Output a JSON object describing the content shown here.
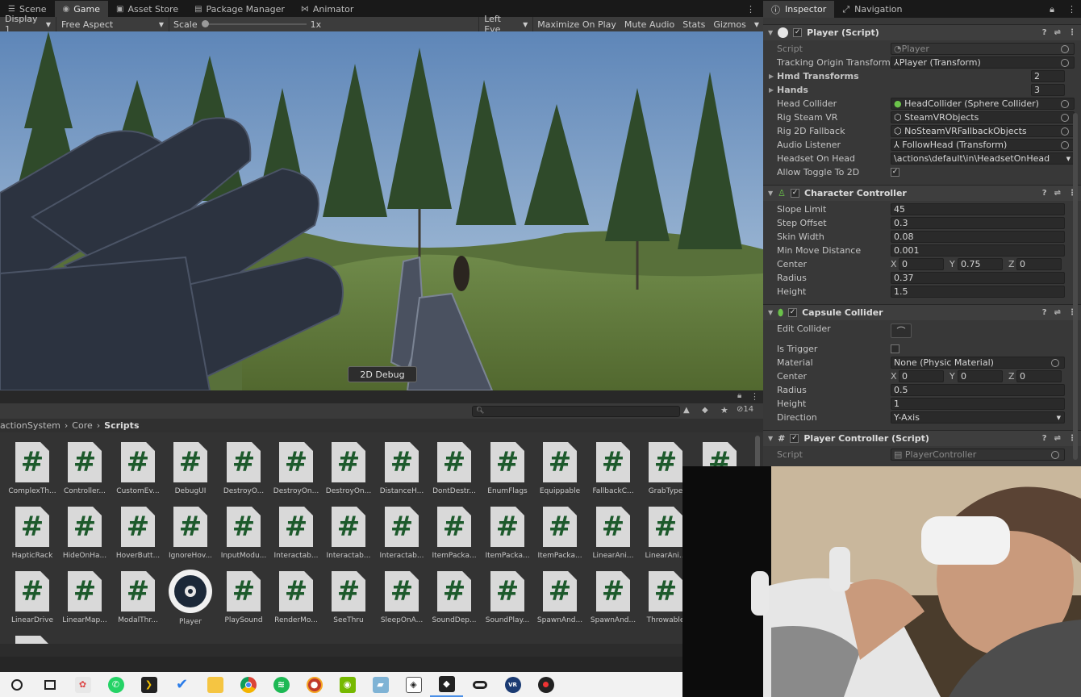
{
  "tabs": {
    "scene": "Scene",
    "game": "Game",
    "asset_store": "Asset Store",
    "package_manager": "Package Manager",
    "animator": "Animator"
  },
  "game_toolbar": {
    "display": "Display 1",
    "aspect": "Free Aspect",
    "scale_label": "Scale",
    "scale_value": "1x",
    "eye": "Left Eye",
    "maximize": "Maximize On Play",
    "mute": "Mute Audio",
    "stats": "Stats",
    "gizmos": "Gizmos"
  },
  "game_view": {
    "debug_button": "2D Debug"
  },
  "project": {
    "hidden_count": "14",
    "breadcrumb": [
      "actionSystem",
      "Core",
      "Scripts"
    ],
    "assets": [
      "ComplexTh...",
      "Controller...",
      "CustomEv...",
      "DebugUI",
      "DestroyO...",
      "DestroyOn...",
      "DestroyOn...",
      "DistanceH...",
      "DontDestr...",
      "EnumFlags",
      "Equippable",
      "FallbackC...",
      "GrabType",
      "HapticRack",
      "HideOnHa...",
      "HoverButt...",
      "IgnoreHov...",
      "InputModu...",
      "Interactab...",
      "Interactab...",
      "Interactab...",
      "ItemPacka...",
      "ItemPacka...",
      "ItemPacka...",
      "LinearAni...",
      "LinearAni...",
      "LinearDrive",
      "LinearMap...",
      "ModalThr...",
      "Player",
      "PlaySound",
      "RenderMo...",
      "SeeThru",
      "SleepOnA...",
      "SoundDep...",
      "SoundPlay...",
      "SpawnAnd...",
      "SpawnAnd...",
      "Throwable"
    ]
  },
  "inspector": {
    "tab": "Inspector",
    "nav_tab": "Navigation",
    "player_script": {
      "title": "Player (Script)",
      "rows": [
        {
          "label": "Script",
          "value": "Player"
        },
        {
          "label": "Tracking Origin Transform",
          "value": "Player (Transform)"
        },
        {
          "label": "Hmd Transforms",
          "value": "2"
        },
        {
          "label": "Hands",
          "value": "3"
        },
        {
          "label": "Head Collider",
          "value": "HeadCollider (Sphere Collider)"
        },
        {
          "label": "Rig Steam VR",
          "value": "SteamVRObjects"
        },
        {
          "label": "Rig 2D Fallback",
          "value": "NoSteamVRFallbackObjects"
        },
        {
          "label": "Audio Listener",
          "value": "FollowHead (Transform)"
        },
        {
          "label": "Headset On Head",
          "value": "\\actions\\default\\in\\HeadsetOnHead"
        },
        {
          "label": "Allow Toggle To 2D",
          "value": "✓"
        }
      ]
    },
    "character_controller": {
      "title": "Character Controller",
      "rows": [
        {
          "label": "Slope Limit",
          "value": "45"
        },
        {
          "label": "Step Offset",
          "value": "0.3"
        },
        {
          "label": "Skin Width",
          "value": "0.08"
        },
        {
          "label": "Min Move Distance",
          "value": "0.001"
        },
        {
          "label": "Center",
          "x": "0",
          "y": "0.75",
          "z": "0"
        },
        {
          "label": "Radius",
          "value": "0.37"
        },
        {
          "label": "Height",
          "value": "1.5"
        }
      ]
    },
    "capsule_collider": {
      "title": "Capsule Collider",
      "rows": [
        {
          "label": "Edit Collider"
        },
        {
          "label": "Is Trigger"
        },
        {
          "label": "Material",
          "value": "None (Physic Material)"
        },
        {
          "label": "Center",
          "x": "0",
          "y": "0",
          "z": "0"
        },
        {
          "label": "Radius",
          "value": "0.5"
        },
        {
          "label": "Height",
          "value": "1"
        },
        {
          "label": "Direction",
          "value": "Y-Axis"
        }
      ]
    },
    "player_controller": {
      "title": "Player Controller (Script)",
      "script_label": "Script",
      "script_value": "PlayerController"
    },
    "axis_labels": {
      "x": "X",
      "y": "Y",
      "z": "Z"
    }
  },
  "colors": {
    "editor_dark": "#282828",
    "panel": "#383838",
    "script_icon": "#1d5a2c",
    "taskbar": "#f2f2f2"
  }
}
